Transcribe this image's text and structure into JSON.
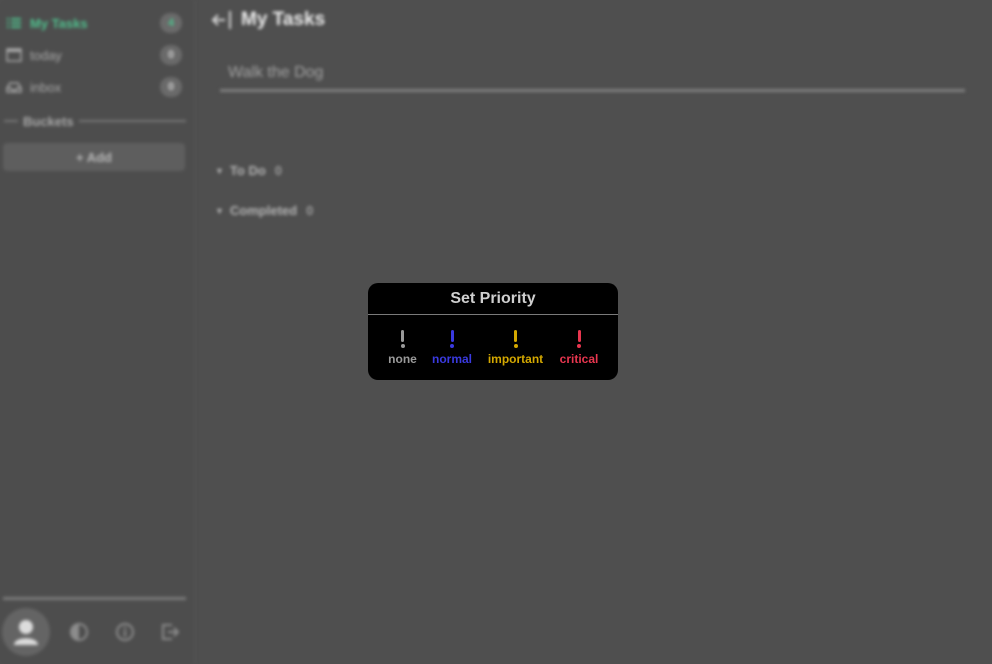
{
  "sidebar": {
    "items": [
      {
        "label": "My Tasks",
        "count": "4",
        "icon": "list-icon"
      },
      {
        "label": "today",
        "count": "0",
        "icon": "calendar-icon"
      },
      {
        "label": "inbox",
        "count": "0",
        "icon": "inbox-icon"
      }
    ],
    "buckets_title": "Buckets",
    "add_label": "+ Add",
    "footer_icons": [
      "user-icon",
      "theme-icon",
      "info-icon",
      "logout-icon"
    ]
  },
  "main": {
    "title": "My Tasks",
    "task_input_value": "Walk the Dog",
    "sections": [
      {
        "label": "To Do",
        "count": "0"
      },
      {
        "label": "Completed",
        "count": "0"
      }
    ]
  },
  "priority_modal": {
    "title": "Set Priority",
    "options": [
      {
        "label": "none",
        "color": "#9a9a9a"
      },
      {
        "label": "normal",
        "color": "#3a3ae0"
      },
      {
        "label": "important",
        "color": "#d4a800"
      },
      {
        "label": "critical",
        "color": "#e8364f"
      }
    ]
  },
  "colors": {
    "accent": "#4fc08d",
    "background": "#4f4f4f"
  }
}
